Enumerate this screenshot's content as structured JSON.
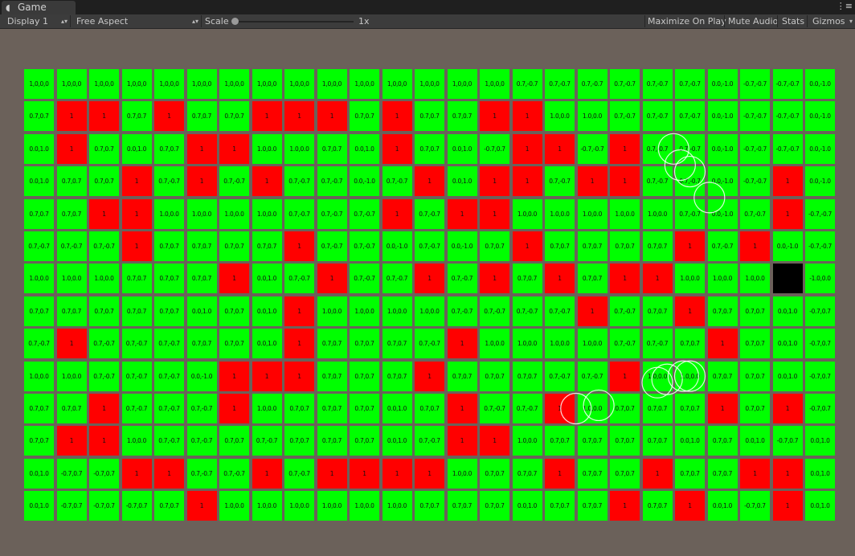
{
  "tabbar": {
    "title": "Game",
    "tab_icon": "unity-icon",
    "menu_icon": "window-menu-icon",
    "menu_glyph": "⋮≡"
  },
  "toolbar": {
    "display": "Display 1",
    "aspect": "Free Aspect",
    "scale_label": "Scale",
    "scale_value": "1x",
    "scale_fraction": 0,
    "maximize": "Maximize On Play",
    "mute": "Mute Audio",
    "stats": "Stats",
    "gizmos": "Gizmos"
  },
  "colors": {
    "safe": "#00ff00",
    "hazard": "#ff0000",
    "goal": "#000000",
    "background": "#6b615a"
  },
  "grid": {
    "rows": [
      [
        "1,0,0,0",
        "1,0,0,0",
        "1,0,0,0",
        "1,0,0,0",
        "1,0,0,0",
        "1,0,0,0",
        "1,0,0,0",
        "1,0,0,0",
        "1,0,0,0",
        "1,0,0,0",
        "1,0,0,0",
        "1,0,0,0",
        "1,0,0,0",
        "1,0,0,0",
        "1,0,0,0",
        "0.7,-0.7",
        "0.7,-0.7",
        "0.7,-0.7",
        "0.7,-0.7",
        "0.7,-0.7",
        "0.7,-0.7",
        "0.0,-1.0",
        "-0.7,-0.7",
        "-0.7,-0.7",
        "0.0,-1.0"
      ],
      [
        "0.7,0.7",
        "1",
        "1",
        "0.7,0.7",
        "1",
        "0.7,0.7",
        "0.7,0.7",
        "1",
        "1",
        "1",
        "0.7,0.7",
        "1",
        "0.7,0.7",
        "0.7,0.7",
        "1",
        "1",
        "1.0,0.0",
        "1.0,0.0",
        "0.7,-0.7",
        "0.7,-0.7",
        "0.7,-0.7",
        "0.0,-1.0",
        "-0.7,-0.7",
        "-0.7,-0.7",
        "0.0,-1.0"
      ],
      [
        "0.0,1.0",
        "1",
        "0.7,0.7",
        "0.0,1.0",
        "0.7,0.7",
        "1",
        "1",
        "1.0,0.0",
        "1.0,0.0",
        "0.7,0.7",
        "0.0,1.0",
        "1",
        "0.7,0.7",
        "0.0,1.0",
        "-0.7,0.7",
        "1",
        "1",
        "-0.7,-0.7",
        "1",
        "0.7,-0.7",
        "0.7,-0.7",
        "0.0,-1.0",
        "-0.7,-0.7",
        "-0.7,-0.7",
        "0.0,-1.0"
      ],
      [
        "0.0,1.0",
        "0.7,0.7",
        "0.7,0.7",
        "1",
        "0.7,-0.7",
        "1",
        "0.7,-0.7",
        "1",
        "0.7,-0.7",
        "0.7,-0.7",
        "0.0,-1.0",
        "0.7,-0.7",
        "1",
        "0.0,1.0",
        "1",
        "1",
        "0.7,-0.7",
        "1",
        "1",
        "0.7,-0.7",
        "0.7,-0.7",
        "0.0,-1.0",
        "-0.7,-0.7",
        "1",
        "0.0,-1.0"
      ],
      [
        "0.7,0.7",
        "0.7,0.7",
        "1",
        "1",
        "1.0,0.0",
        "1.0,0.0",
        "1.0,0.0",
        "1.0,0.0",
        "0.7,-0.7",
        "0.7,-0.7",
        "0.7,-0.7",
        "1",
        "0.7,-0.7",
        "1",
        "1",
        "1.0,0.0",
        "1.0,0.0",
        "1.0,0.0",
        "1.0,0.0",
        "1.0,0.0",
        "0.7,-0.7",
        "0.0,-1.0",
        "0.7,-0.7",
        "1",
        "-0.7,-0.7"
      ],
      [
        "0.7,-0.7",
        "0.7,-0.7",
        "0.7,-0.7",
        "1",
        "0.7,0.7",
        "0.7,0.7",
        "0.7,0.7",
        "0.7,0.7",
        "1",
        "0.7,-0.7",
        "0.7,-0.7",
        "0.0,-1.0",
        "0.7,-0.7",
        "0.0,-1.0",
        "0.7,0.7",
        "1",
        "0.7,0.7",
        "0.7,0.7",
        "0.7,0.7",
        "0.7,0.7",
        "1",
        "0.7,-0.7",
        "1",
        "0.0,-1.0",
        "-0.7,-0.7"
      ],
      [
        "1.0,0.0",
        "1.0,0.0",
        "1.0,0.0",
        "0.7,0.7",
        "0.7,0.7",
        "0.7,0.7",
        "1",
        "0.0,1.0",
        "0.7,-0.7",
        "1",
        "0.7,-0.7",
        "0.7,-0.7",
        "1",
        "0.7,-0.7",
        "1",
        "0.7,0.7",
        "1",
        "0.7,0.7",
        "1",
        "1",
        "1.0,0.0",
        "1.0,0.0",
        "1.0,0.0",
        "",
        "-1.0,0.0"
      ],
      [
        "0.7,0.7",
        "0.7,0.7",
        "0.7,0.7",
        "0.7,0.7",
        "0.7,0.7",
        "0.0,1.0",
        "0.7,0.7",
        "0.0,1.0",
        "1",
        "1.0,0.0",
        "1.0,0.0",
        "1.0,0.0",
        "1.0,0.0",
        "0.7,-0.7",
        "0.7,-0.7",
        "0.7,-0.7",
        "0.7,-0.7",
        "1",
        "0.7,-0.7",
        "0.7,0.7",
        "1",
        "0.7,0.7",
        "0.7,0.7",
        "0.0,1.0",
        "-0.7,0.7"
      ],
      [
        "0.7,-0.7",
        "1",
        "0.7,-0.7",
        "0.7,-0.7",
        "0.7,-0.7",
        "0.7,0.7",
        "0.7,0.7",
        "0.0,1.0",
        "1",
        "0.7,0.7",
        "0.7,0.7",
        "0.7,0.7",
        "0.7,-0.7",
        "1",
        "1.0,0.0",
        "1.0,0.0",
        "1.0,0.0",
        "1.0,0.0",
        "0.7,-0.7",
        "0.7,-0.7",
        "0.7,0.7",
        "1",
        "0.7,0.7",
        "0.0,1.0",
        "-0.7,0.7"
      ],
      [
        "1.0,0.0",
        "1.0,0.0",
        "0.7,-0.7",
        "0.7,-0.7",
        "0.7,-0.7",
        "0.0,-1.0",
        "1",
        "1",
        "1",
        "0.7,0.7",
        "0.7,0.7",
        "0.7,0.7",
        "1",
        "0.7,0.7",
        "0.7,0.7",
        "0.7,0.7",
        "0.7,-0.7",
        "0.7,-0.7",
        "1",
        "1.0,0.0",
        "1.0,0.0",
        "0.7,0.7",
        "0.7,0.7",
        "0.0,1.0",
        "-0.7,0.7"
      ],
      [
        "0.7,0.7",
        "0.7,0.7",
        "1",
        "0.7,-0.7",
        "0.7,-0.7",
        "0.7,-0.7",
        "1",
        "1.0,0.0",
        "0.7,0.7",
        "0.7,0.7",
        "0.7,0.7",
        "0.0,1.0",
        "0.7,0.7",
        "1",
        "0.7,-0.7",
        "0.7,-0.7",
        "1",
        "1.0,0.0",
        "0.7,0.7",
        "0.7,0.7",
        "0.7,0.7",
        "1",
        "0.7,0.7",
        "1",
        "-0.7,0.7"
      ],
      [
        "0.7,0.7",
        "1",
        "1",
        "1.0,0.0",
        "0.7,-0.7",
        "0.7,-0.7",
        "0.7,0.7",
        "0.7,-0.7",
        "0.7,0.7",
        "0.7,0.7",
        "0.7,0.7",
        "0.0,1.0",
        "0.7,-0.7",
        "1",
        "1",
        "1.0,0.0",
        "0.7,0.7",
        "0.7,0.7",
        "0.7,0.7",
        "0.7,0.7",
        "0.0,1.0",
        "0.7,0.7",
        "0.0,1.0",
        "-0.7,0.7",
        "0.0,1.0"
      ],
      [
        "0.0,1.0",
        "-0.7,0.7",
        "-0.7,0.7",
        "1",
        "1",
        "0.7,-0.7",
        "0.7,-0.7",
        "1",
        "0.7,-0.7",
        "1",
        "1",
        "1",
        "1",
        "1.0,0.0",
        "0.7,0.7",
        "0.7,0.7",
        "1",
        "0.7,0.7",
        "0.7,0.7",
        "1",
        "0.7,0.7",
        "0.7,0.7",
        "1",
        "1",
        "0.0,1.0"
      ],
      [
        "0.0,1.0",
        "-0.7,0.7",
        "-0.7,0.7",
        "-0.7,0.7",
        "0.7,0.7",
        "1",
        "1.0,0.0",
        "1.0,0.0",
        "1.0,0.0",
        "1.0,0.0",
        "1.0,0.0",
        "1.0,0.0",
        "0.7,0.7",
        "0.7,0.7",
        "0.7,0.7",
        "0.0,1.0",
        "0.7,0.7",
        "0.7,0.7",
        "1",
        "0.7,0.7",
        "1",
        "0.0,1.0",
        "-0.7,0.7",
        "1",
        "0.0,1.0"
      ]
    ],
    "hazard_label": "1",
    "goal_cell": {
      "row": 6,
      "col": 23
    }
  },
  "gizmo_circles": [
    {
      "row": 2,
      "col": 19,
      "dx": 0.5,
      "dy": 0.0
    },
    {
      "row": 2,
      "col": 20,
      "dx": -0.3,
      "dy": 0.5
    },
    {
      "row": 2,
      "col": 20,
      "dx": 0.0,
      "dy": 0.7
    },
    {
      "row": 3,
      "col": 20,
      "dx": 0.6,
      "dy": 0.5
    },
    {
      "row": 9,
      "col": 19,
      "dx": 0.0,
      "dy": 0.2
    },
    {
      "row": 9,
      "col": 19,
      "dx": 0.3,
      "dy": 0.1
    },
    {
      "row": 9,
      "col": 20,
      "dx": 0.0,
      "dy": 0.0
    },
    {
      "row": 9,
      "col": 20,
      "dx": -0.2,
      "dy": 0.0
    },
    {
      "row": 10,
      "col": 17,
      "dx": -0.5,
      "dy": 0.0
    },
    {
      "row": 10,
      "col": 18,
      "dx": -0.8,
      "dy": -0.1
    }
  ]
}
